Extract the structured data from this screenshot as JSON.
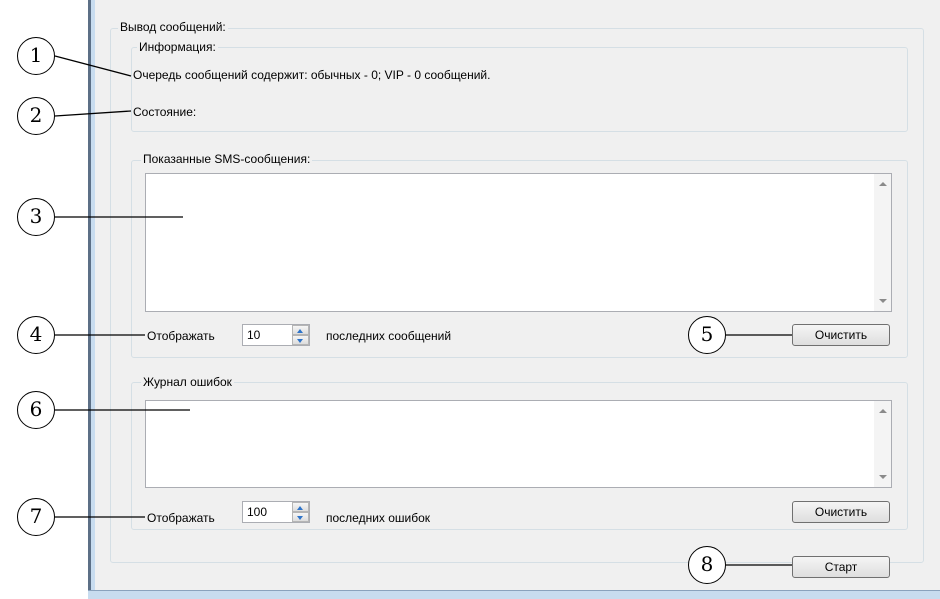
{
  "output_group": {
    "title": "Вывод сообщений:"
  },
  "info_group": {
    "title": "Информация:",
    "queue_text": "Очередь сообщений содержит: обычных -   0; VIP - 0 сообщений.",
    "status_label": "Состояние:"
  },
  "sms_group": {
    "title": "Показанные SMS-сообщения:",
    "show_label": "Отображать",
    "count_value": "10",
    "suffix_label": "последних сообщений",
    "clear_label": "Очистить"
  },
  "error_group": {
    "title": "Журнал ошибок",
    "show_label": "Отображать",
    "count_value": "100",
    "suffix_label": "последних ошибок",
    "clear_label": "Очистить"
  },
  "start_label": "Старт",
  "callouts": [
    "1",
    "2",
    "3",
    "4",
    "5",
    "6",
    "7",
    "8"
  ],
  "colors": {
    "window_frame": "#c8dcef",
    "form_bg": "#f0f0f0",
    "spin_arrow": "#2d73c9"
  }
}
